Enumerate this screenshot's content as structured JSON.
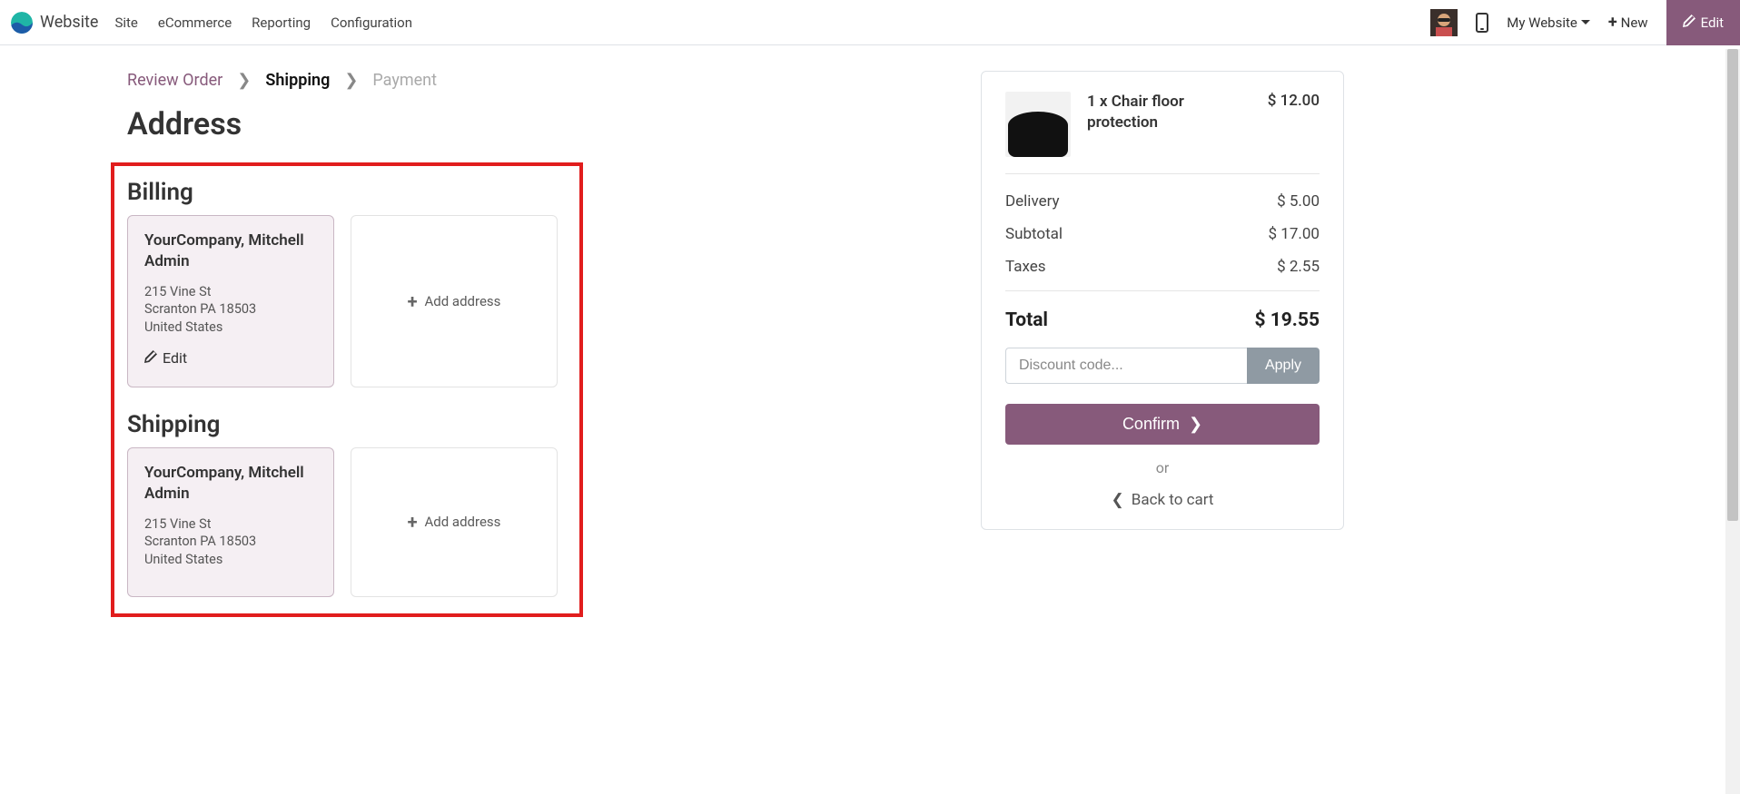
{
  "brand": {
    "title": "Website"
  },
  "nav": {
    "items": [
      "Site",
      "eCommerce",
      "Reporting",
      "Configuration"
    ],
    "my_website": "My Website",
    "new_label": "New",
    "edit_label": "Edit"
  },
  "breadcrumb": {
    "step1": "Review Order",
    "step2": "Shipping",
    "step3": "Payment"
  },
  "page_title": "Address",
  "billing": {
    "heading": "Billing",
    "name": "YourCompany, Mitchell Admin",
    "line1": "215 Vine St",
    "line2": "Scranton PA 18503",
    "line3": "United States",
    "edit_label": "Edit",
    "add_label": "Add address"
  },
  "shipping": {
    "heading": "Shipping",
    "name": "YourCompany, Mitchell Admin",
    "line1": "215 Vine St",
    "line2": "Scranton PA 18503",
    "line3": "United States",
    "add_label": "Add address"
  },
  "summary": {
    "item_title": "1 x Chair floor protection",
    "item_price": "$ 12.00",
    "delivery_label": "Delivery",
    "delivery_value": "$ 5.00",
    "subtotal_label": "Subtotal",
    "subtotal_value": "$ 17.00",
    "taxes_label": "Taxes",
    "taxes_value": "$ 2.55",
    "total_label": "Total",
    "total_value": "$ 19.55",
    "discount_placeholder": "Discount code...",
    "apply_label": "Apply",
    "confirm_label": "Confirm",
    "or_label": "or",
    "back_label": "Back to cart"
  }
}
